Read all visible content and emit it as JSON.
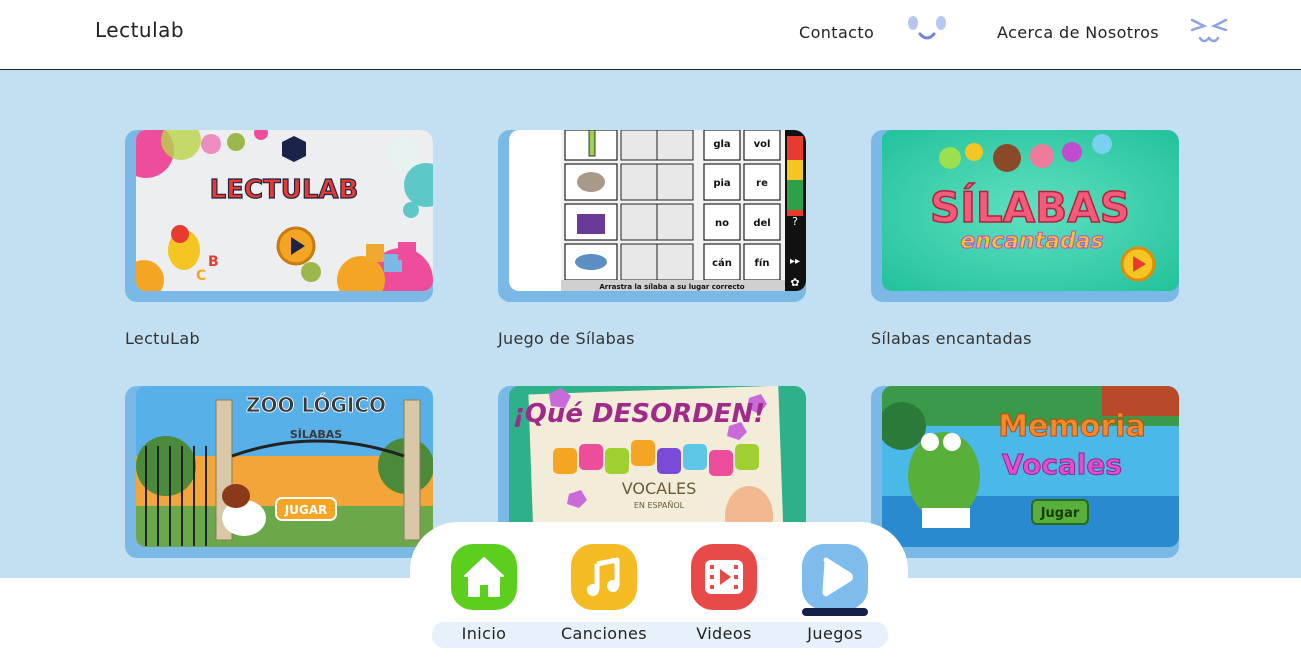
{
  "header": {
    "brand": "Lectulab",
    "nav": [
      {
        "label": "Contacto"
      },
      {
        "label": "Acerca de Nosotros"
      }
    ]
  },
  "games": [
    {
      "title": "LectuLab",
      "thumb_text": "LECTULAB"
    },
    {
      "title": "Juego de Sílabas",
      "thumb_words": [
        "gla",
        "vol",
        "pia",
        "re",
        "no",
        "del",
        "cán",
        "fín"
      ],
      "thumb_caption": "Arrastra la sílaba a su lugar correcto"
    },
    {
      "title": "Sílabas encantadas",
      "thumb_text": "SÍLABAS",
      "thumb_subtext": "encantadas"
    },
    {
      "title": "",
      "thumb_text": "ZOO LÓGICO",
      "thumb_subtext": "SÍLABAS",
      "thumb_button": "JUGAR"
    },
    {
      "title": "",
      "thumb_text": "¡Qué DESORDEN!",
      "thumb_subtext": "VOCALES",
      "thumb_small": "EN ESPAÑOL"
    },
    {
      "title": "",
      "thumb_text": "Memoria",
      "thumb_subtext": "Vocales",
      "thumb_button": "Jugar"
    }
  ],
  "bottom_nav": {
    "items": [
      {
        "label": "Inicio",
        "icon": "home-icon",
        "color": "#5ccf1e"
      },
      {
        "label": "Canciones",
        "icon": "music-note-icon",
        "color": "#f5bb22"
      },
      {
        "label": "Videos",
        "icon": "film-icon",
        "color": "#e84a4a"
      },
      {
        "label": "Juegos",
        "icon": "play-icon",
        "color": "#7dbcec"
      }
    ],
    "active": "Juegos"
  },
  "colors": {
    "main_bg": "#c2e0f2",
    "card_frame": "#7ab8e6",
    "active_indicator": "#142146"
  }
}
